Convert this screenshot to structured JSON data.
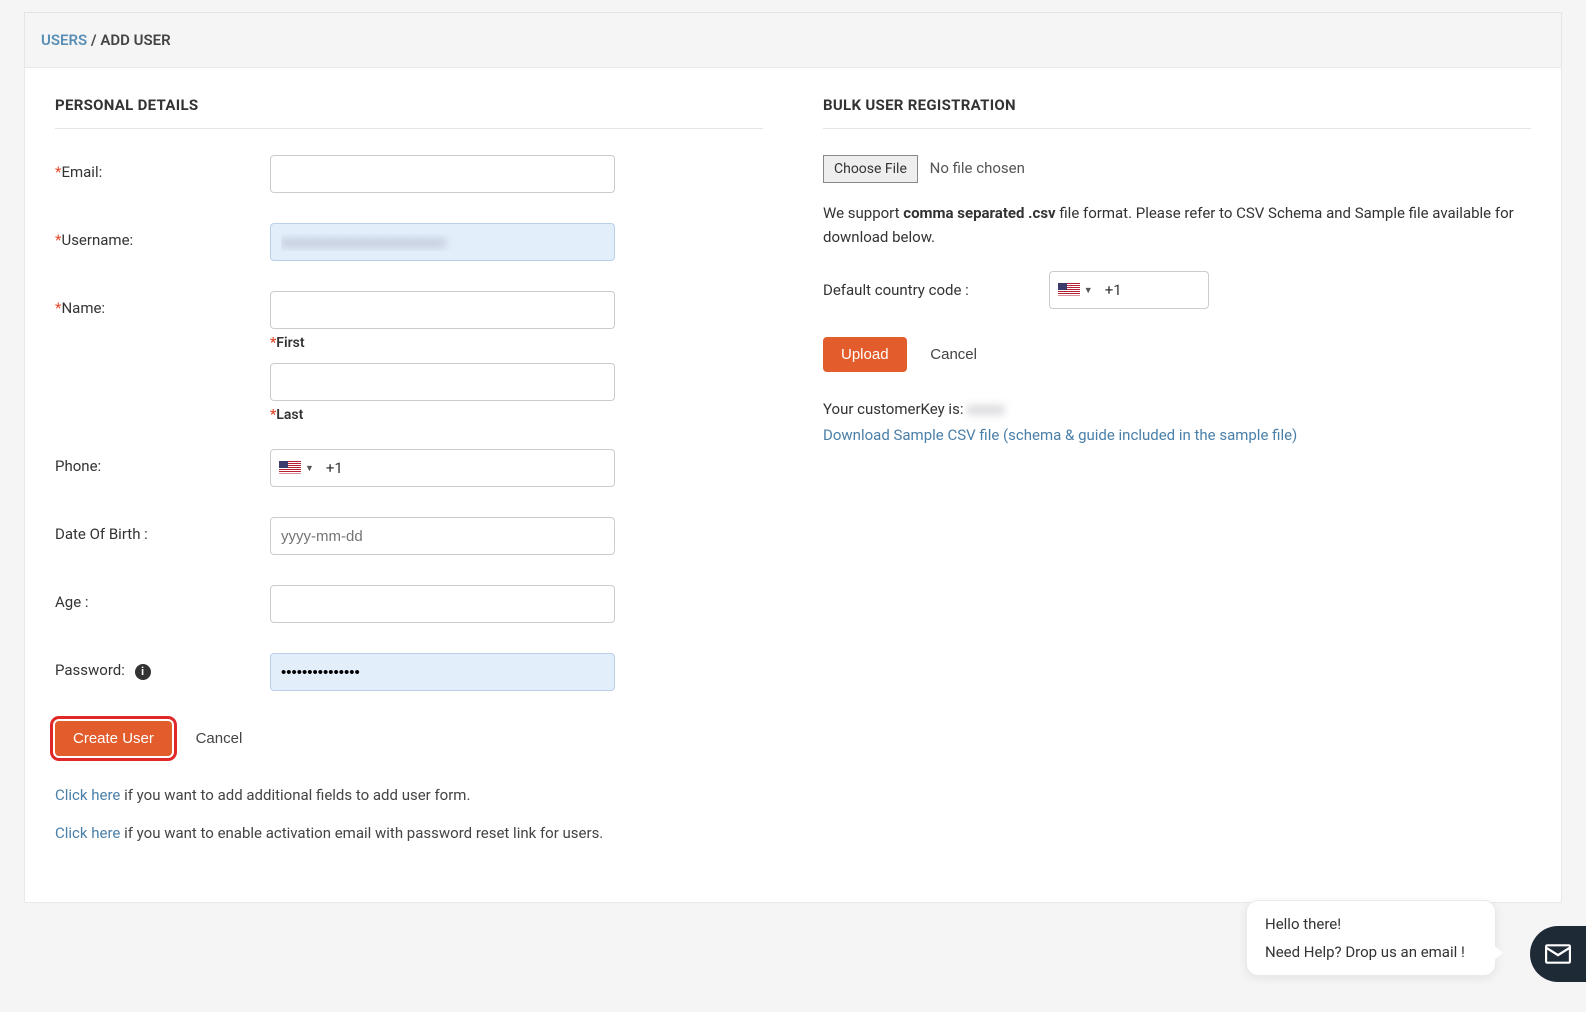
{
  "breadcrumb": {
    "parent": "USERS",
    "sep": "/",
    "current": "ADD USER"
  },
  "left": {
    "title": "PERSONAL DETAILS",
    "email_label": "Email:",
    "username_label": "Username:",
    "username_value": "xxxxxxxxxxxxxxxxxxxxxx",
    "name_label": "Name:",
    "first_label": "First",
    "last_label": "Last",
    "phone_label": "Phone:",
    "phone_code": "+1",
    "dob_label": "Date Of Birth :",
    "dob_placeholder": "yyyy-mm-dd",
    "age_label": "Age :",
    "password_label": "Password:",
    "password_value": "•••••••••••••••",
    "create_btn": "Create User",
    "cancel_btn": "Cancel",
    "hint1_link": "Click here",
    "hint1_text": " if you want to add additional fields to add user form.",
    "hint2_link": "Click here",
    "hint2_text": " if you want to enable activation email with password reset link for users."
  },
  "right": {
    "title": "BULK USER REGISTRATION",
    "choose_file": "Choose File",
    "no_file": "No file chosen",
    "support_pre": "We support ",
    "support_strong": "comma separated .csv",
    "support_post": " file format. Please refer to CSV Schema and Sample file available for download below.",
    "cc_label": "Default country code :",
    "cc_code": "+1",
    "upload_btn": "Upload",
    "cancel_btn": "Cancel",
    "key_label": "Your customerKey is: ",
    "key_value": "xxxxx",
    "download_link": "Download Sample CSV file (schema & guide included in the sample file)"
  },
  "chat": {
    "line1": "Hello there!",
    "line2": "Need Help? Drop us an email !"
  }
}
